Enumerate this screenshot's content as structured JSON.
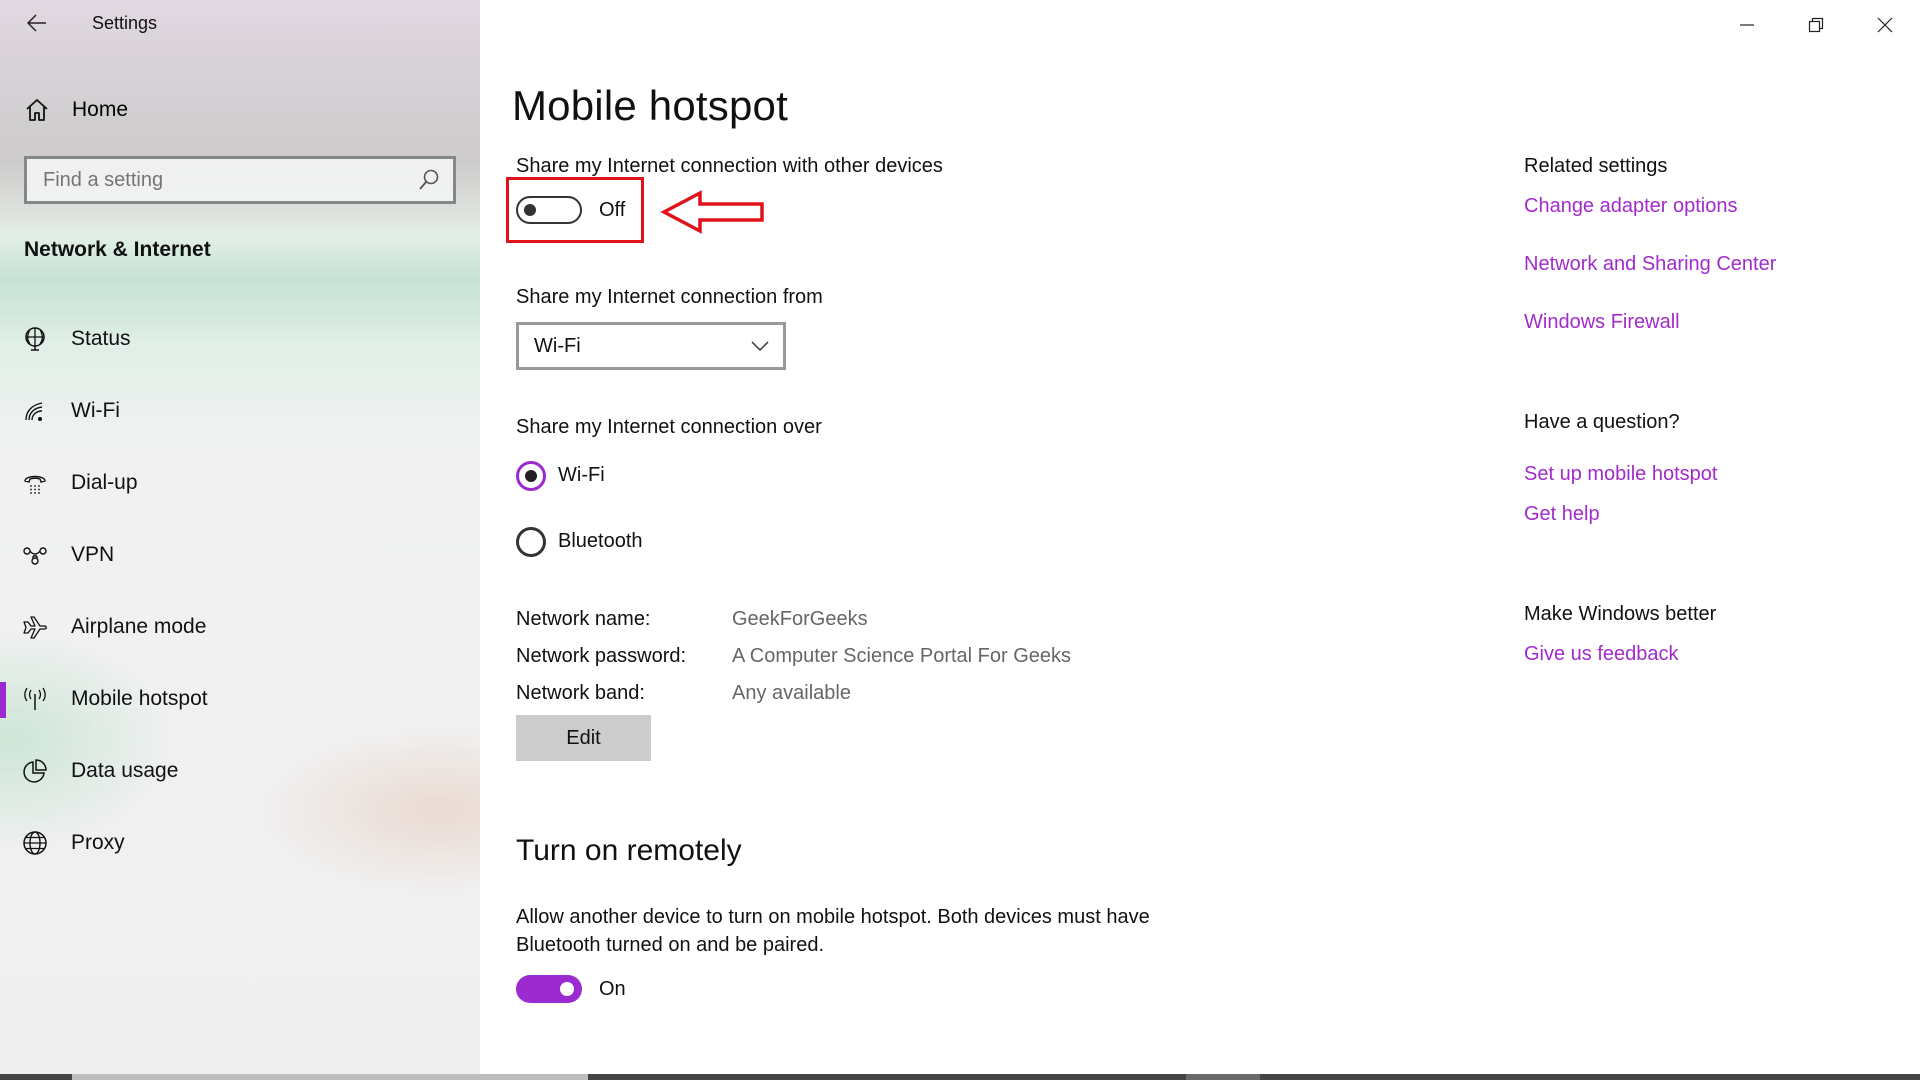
{
  "window": {
    "title": "Settings",
    "back_icon": "arrow-left-icon",
    "controls": {
      "minimize_icon": "minimize-icon",
      "restore_icon": "restore-icon",
      "close_icon": "close-icon"
    }
  },
  "sidebar": {
    "home_label": "Home",
    "home_icon": "home-icon",
    "search": {
      "placeholder": "Find a setting",
      "value": "",
      "icon": "search-icon"
    },
    "section_title": "Network & Internet",
    "items": [
      {
        "label": "Status",
        "icon": "globe-monitor-icon",
        "active": false
      },
      {
        "label": "Wi-Fi",
        "icon": "wifi-icon",
        "active": false
      },
      {
        "label": "Dial-up",
        "icon": "phone-icon",
        "active": false
      },
      {
        "label": "VPN",
        "icon": "vpn-icon",
        "active": false
      },
      {
        "label": "Airplane mode",
        "icon": "airplane-icon",
        "active": false
      },
      {
        "label": "Mobile hotspot",
        "icon": "antenna-icon",
        "active": true
      },
      {
        "label": "Data usage",
        "icon": "pie-chart-icon",
        "active": false
      },
      {
        "label": "Proxy",
        "icon": "globe-icon",
        "active": false
      }
    ]
  },
  "main": {
    "title": "Mobile hotspot",
    "share_with": {
      "label": "Share my Internet connection with other devices",
      "toggle_state": "Off",
      "toggle_on": false
    },
    "share_from": {
      "label": "Share my Internet connection from",
      "selected": "Wi-Fi"
    },
    "share_over": {
      "label": "Share my Internet connection over",
      "options": [
        {
          "label": "Wi-Fi",
          "checked": true
        },
        {
          "label": "Bluetooth",
          "checked": false
        }
      ]
    },
    "network_info": [
      {
        "key": "Network name:",
        "value": "GeekForGeeks"
      },
      {
        "key": "Network password:",
        "value": "A Computer Science Portal For Geeks"
      },
      {
        "key": "Network band:",
        "value": "Any available"
      }
    ],
    "edit_label": "Edit",
    "remote": {
      "title": "Turn on remotely",
      "description": "Allow another device to turn on mobile hotspot. Both devices must have Bluetooth turned on and be paired.",
      "toggle_state": "On",
      "toggle_on": true
    }
  },
  "right_panel": {
    "related_heading": "Related settings",
    "related_links": [
      "Change adapter options",
      "Network and Sharing Center",
      "Windows Firewall"
    ],
    "question_heading": "Have a question?",
    "question_links": [
      "Set up mobile hotspot",
      "Get help"
    ],
    "better_heading": "Make Windows better",
    "better_links": [
      "Give us feedback"
    ]
  },
  "annotation": {
    "highlight_color": "#e0121c",
    "arrow_direction": "left"
  },
  "colors": {
    "accent": "#9b2ad1",
    "link": "#a22bcc"
  }
}
